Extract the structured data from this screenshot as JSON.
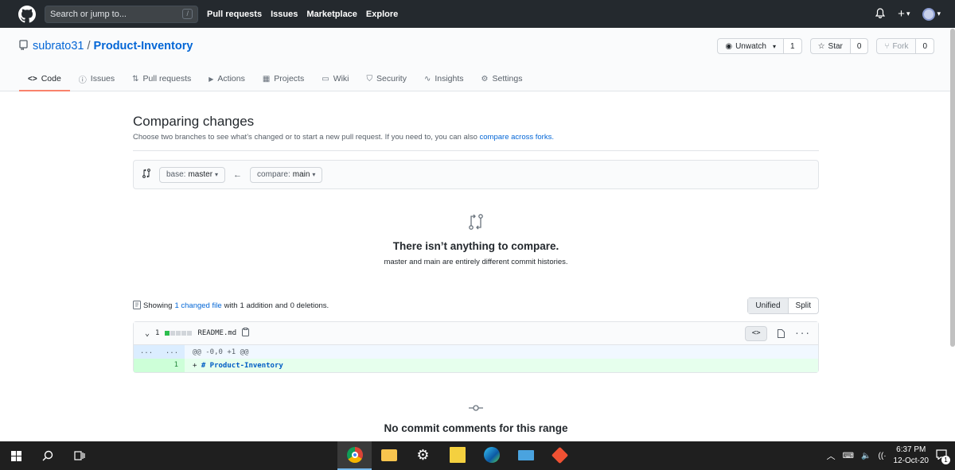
{
  "header": {
    "search_placeholder": "Search or jump to...",
    "search_shortcut": "/",
    "nav": [
      "Pull requests",
      "Issues",
      "Marketplace",
      "Explore"
    ],
    "bell_icon": "bell-icon",
    "plus_label": "+",
    "caret": "▾"
  },
  "repo": {
    "owner": "subrato31",
    "separator": "/",
    "name": "Product-Inventory",
    "unwatch_label": "Unwatch",
    "unwatch_count": "1",
    "star_label": "Star",
    "star_count": "0",
    "fork_label": "Fork",
    "fork_count": "0"
  },
  "tabs": [
    {
      "label": "Code",
      "icon": "<>"
    },
    {
      "label": "Issues",
      "icon": "ⓘ"
    },
    {
      "label": "Pull requests",
      "icon": "⇅"
    },
    {
      "label": "Actions",
      "icon": "▶"
    },
    {
      "label": "Projects",
      "icon": "▦"
    },
    {
      "label": "Wiki",
      "icon": "▭"
    },
    {
      "label": "Security",
      "icon": "⛉"
    },
    {
      "label": "Insights",
      "icon": "∿"
    },
    {
      "label": "Settings",
      "icon": "⚙"
    }
  ],
  "compare": {
    "title": "Comparing changes",
    "description": "Choose two branches to see what’s changed or to start a new pull request. If you need to, you can also",
    "forks_link": "compare across forks.",
    "base_label": "base:",
    "base_value": "master",
    "compare_label": "compare:",
    "compare_value": "main",
    "arrow": "←"
  },
  "blank": {
    "title": "There isn’t anything to compare.",
    "desc_part1": "master",
    "desc_part2": " and ",
    "desc_part3": "main",
    "desc_part4": " are entirely different commit histories."
  },
  "toc": {
    "showing": "Showing",
    "changed_files": "1 changed file",
    "with": "with",
    "additions": "1 addition",
    "and": "and",
    "deletions": "0 deletions."
  },
  "diff_view": {
    "unified": "Unified",
    "split": "Split"
  },
  "file": {
    "changes": "1",
    "name": "README.md",
    "hunk_left": "...",
    "hunk_right": "...",
    "hunk_text": "@@ -0,0 +1 @@",
    "line_number": "1",
    "line_prefix": "+ ",
    "line_code": "# Product-Inventory",
    "more": "···"
  },
  "comments": {
    "title": "No commit comments for this range"
  },
  "taskbar": {
    "time": "6:37 PM",
    "date": "12-Oct-20",
    "notification_count": "1"
  },
  "colors": {
    "header_bg": "#24292e",
    "link": "#0366d6",
    "tab_underline": "#f9826c",
    "addition": "#2cbe4e"
  }
}
